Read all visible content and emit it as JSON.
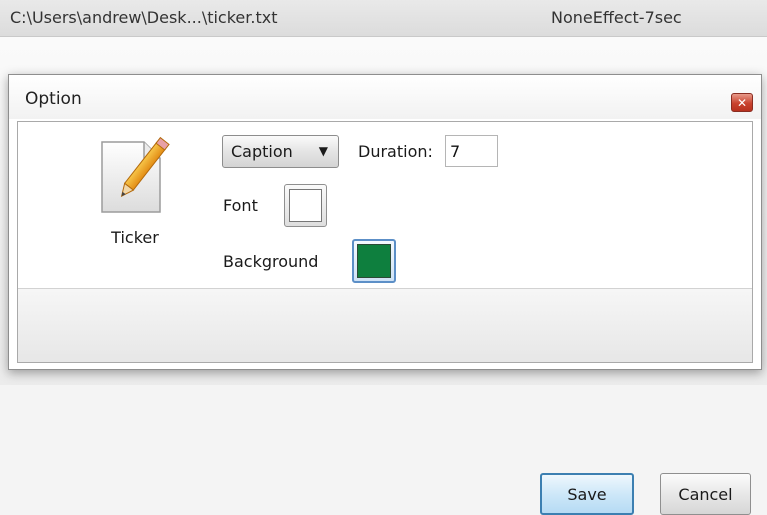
{
  "background": {
    "file_path": "C:\\Users\\andrew\\Desk...\\ticker.txt",
    "effect": "NoneEffect-7sec"
  },
  "dialog": {
    "title": "Option",
    "close_icon": "close-icon",
    "ticker": {
      "icon": "pencil-document-icon",
      "label": "Ticker"
    },
    "caption_select": {
      "value": "Caption",
      "icon": "dropdown-arrow-icon"
    },
    "duration": {
      "label": "Duration:",
      "value": "7"
    },
    "font": {
      "label": "Font",
      "color": "#ffffff"
    },
    "background_color": {
      "label": "Background",
      "color": "#0e7f3e"
    },
    "buttons": {
      "save": "Save",
      "cancel": "Cancel"
    }
  }
}
